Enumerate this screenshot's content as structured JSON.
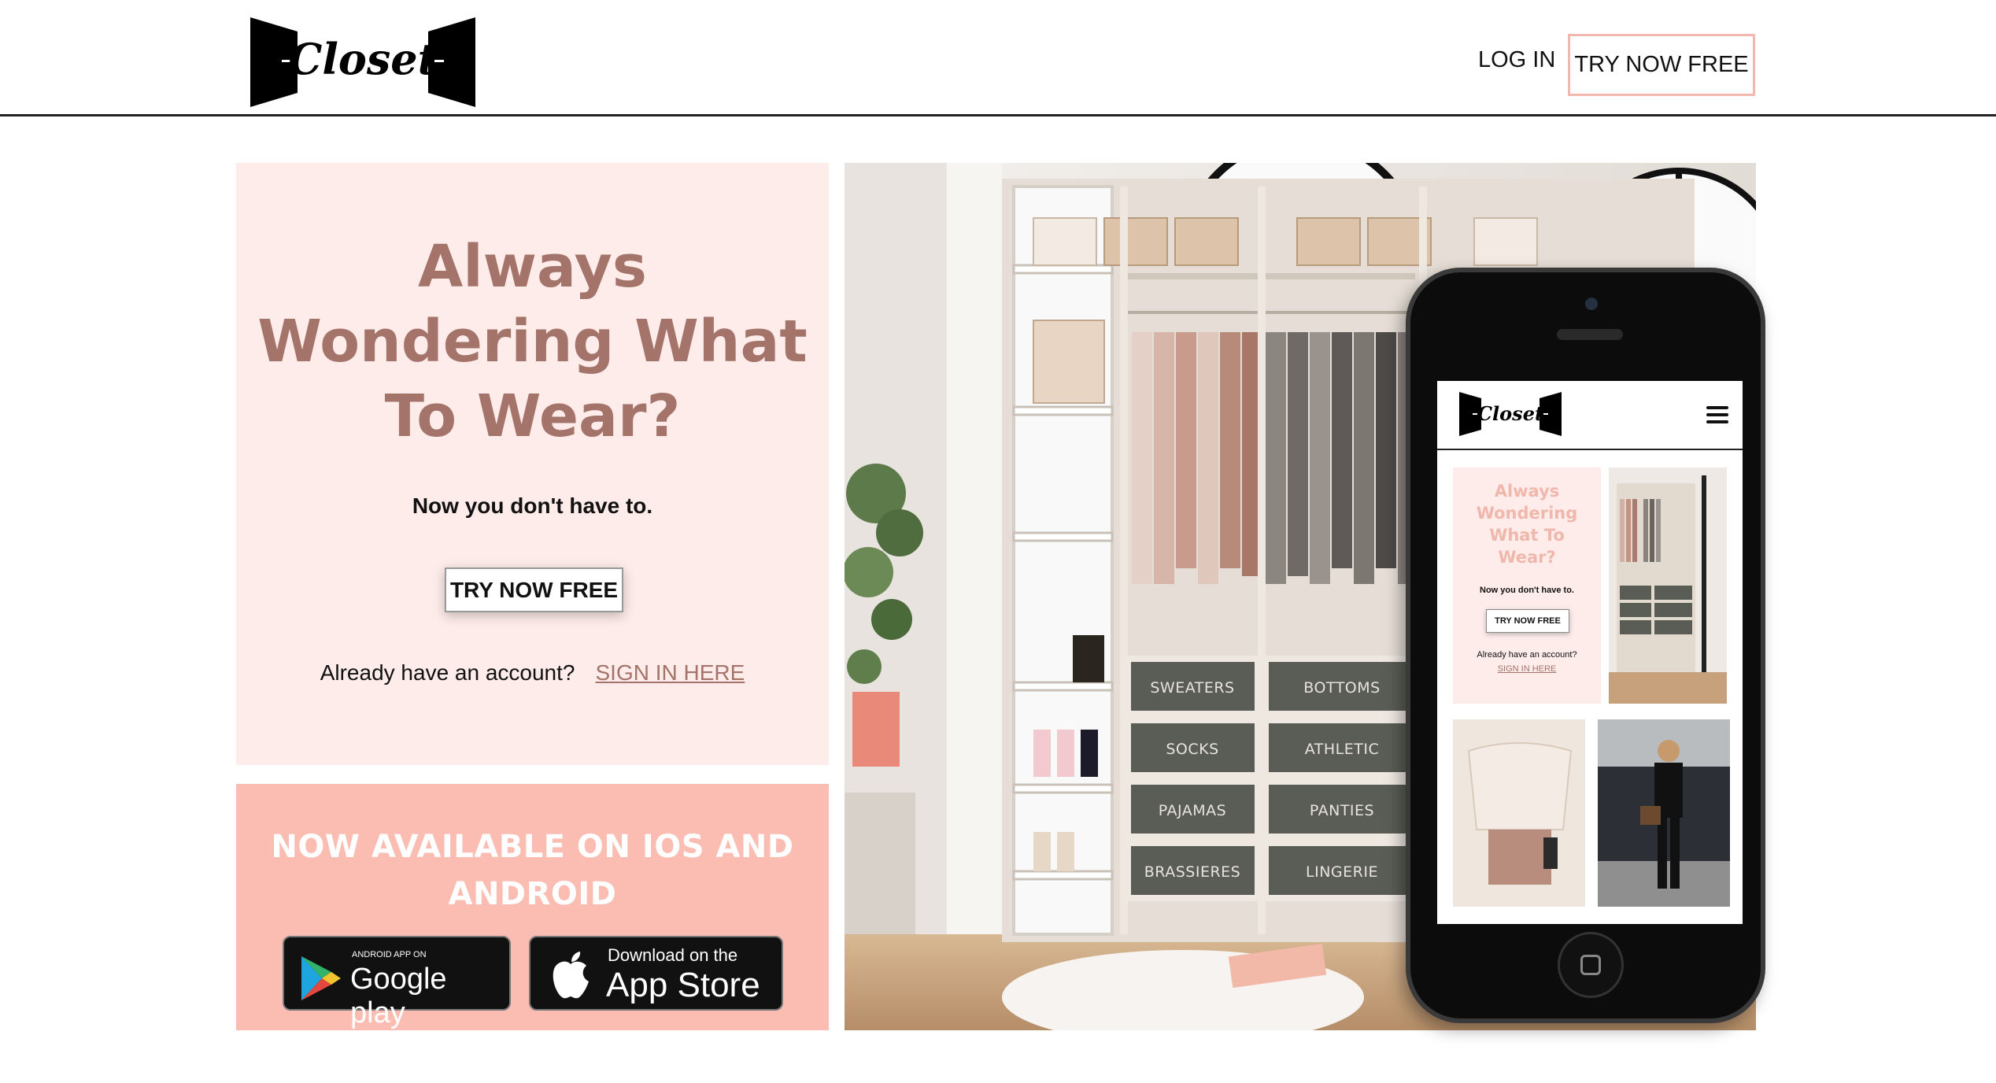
{
  "header": {
    "logo_text": "Closet",
    "login_label": "LOG IN",
    "try_label": "TRY NOW FREE"
  },
  "hero": {
    "title_lines": [
      "Always",
      "Wondering What",
      "To Wear?"
    ],
    "subtitle": "Now you don't have to.",
    "cta_label": "TRY NOW FREE",
    "account_question": "Already have an account?",
    "signin_link": "SIGN IN HERE"
  },
  "availability": {
    "title_lines": [
      "NOW AVAILABLE ON IOS AND",
      "ANDROID"
    ],
    "google_badge": {
      "small": "ANDROID APP ON",
      "big": "Google play"
    },
    "apple_badge": {
      "small": "Download on the",
      "big": "App Store"
    }
  },
  "closet_photo": {
    "drawer_labels": [
      "SWEATERS",
      "BOTTOMS",
      "SOCKS",
      "ATHLETIC",
      "PAJAMAS",
      "PANTIES",
      "BRASSIERES",
      "LINGERIE"
    ]
  },
  "phone_mockup": {
    "logo_text": "Closet",
    "title_lines": [
      "Always",
      "Wondering",
      "What To",
      "Wear?"
    ],
    "subtitle": "Now you don't have to.",
    "cta_label": "TRY NOW FREE",
    "account_question": "Already have an account?",
    "signin_link": "SIGN IN HERE"
  },
  "colors": {
    "brand_text": "#a4736a",
    "hero_bg": "#fdecea",
    "avail_bg": "#fbbdb2",
    "button_border": "#f2b8b0"
  }
}
